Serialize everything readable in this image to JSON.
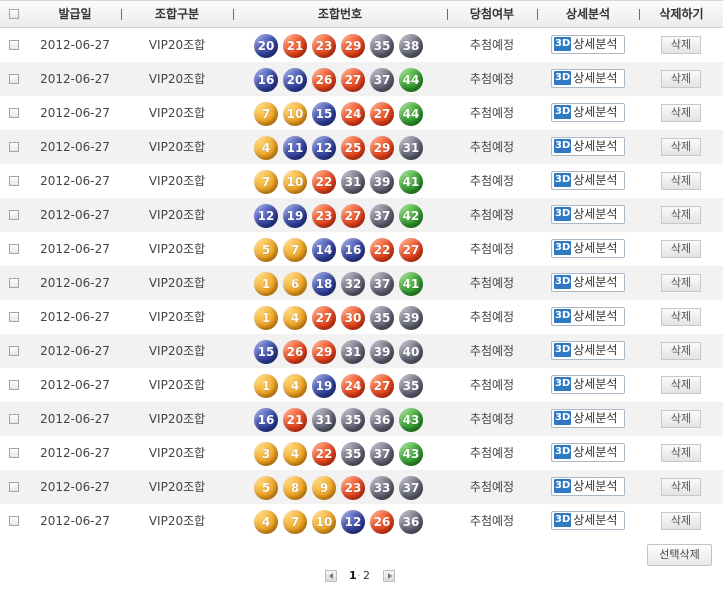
{
  "header": {
    "issue_date": "발급일",
    "combo_type": "조합구분",
    "combo_numbers": "조합번호",
    "win_status": "당첨여부",
    "detail_analysis": "상세분석",
    "delete": "삭제하기"
  },
  "ball_colors": {
    "yellow": "#f0a21e",
    "blue": "#2f3f9e",
    "red": "#e8401a",
    "gray": "#5e6073",
    "green": "#2f9a2b"
  },
  "row_labels": {
    "detail_badge": "3D",
    "detail_text": "상세분석",
    "delete_text": "삭제"
  },
  "rows": [
    {
      "date": "2012-06-27",
      "type": "VIP20조합",
      "status": "추첨예정",
      "numbers": [
        20,
        21,
        23,
        29,
        35,
        38
      ]
    },
    {
      "date": "2012-06-27",
      "type": "VIP20조합",
      "status": "추첨예정",
      "numbers": [
        16,
        20,
        26,
        27,
        37,
        44
      ]
    },
    {
      "date": "2012-06-27",
      "type": "VIP20조합",
      "status": "추첨예정",
      "numbers": [
        7,
        10,
        15,
        24,
        27,
        44
      ]
    },
    {
      "date": "2012-06-27",
      "type": "VIP20조합",
      "status": "추첨예정",
      "numbers": [
        4,
        11,
        12,
        25,
        29,
        31
      ]
    },
    {
      "date": "2012-06-27",
      "type": "VIP20조합",
      "status": "추첨예정",
      "numbers": [
        7,
        10,
        22,
        31,
        39,
        41
      ]
    },
    {
      "date": "2012-06-27",
      "type": "VIP20조합",
      "status": "추첨예정",
      "numbers": [
        12,
        19,
        23,
        27,
        37,
        42
      ]
    },
    {
      "date": "2012-06-27",
      "type": "VIP20조합",
      "status": "추첨예정",
      "numbers": [
        5,
        7,
        14,
        16,
        22,
        27
      ]
    },
    {
      "date": "2012-06-27",
      "type": "VIP20조합",
      "status": "추첨예정",
      "numbers": [
        1,
        6,
        18,
        32,
        37,
        41
      ]
    },
    {
      "date": "2012-06-27",
      "type": "VIP20조합",
      "status": "추첨예정",
      "numbers": [
        1,
        4,
        27,
        30,
        35,
        39
      ]
    },
    {
      "date": "2012-06-27",
      "type": "VIP20조합",
      "status": "추첨예정",
      "numbers": [
        15,
        26,
        29,
        31,
        39,
        40
      ]
    },
    {
      "date": "2012-06-27",
      "type": "VIP20조합",
      "status": "추첨예정",
      "numbers": [
        1,
        4,
        19,
        24,
        27,
        35
      ]
    },
    {
      "date": "2012-06-27",
      "type": "VIP20조합",
      "status": "추첨예정",
      "numbers": [
        16,
        21,
        31,
        35,
        36,
        43
      ]
    },
    {
      "date": "2012-06-27",
      "type": "VIP20조합",
      "status": "추첨예정",
      "numbers": [
        3,
        4,
        22,
        35,
        37,
        43
      ]
    },
    {
      "date": "2012-06-27",
      "type": "VIP20조합",
      "status": "추첨예정",
      "numbers": [
        5,
        8,
        9,
        23,
        33,
        37
      ]
    },
    {
      "date": "2012-06-27",
      "type": "VIP20조합",
      "status": "추첨예정",
      "numbers": [
        4,
        7,
        10,
        12,
        26,
        36
      ]
    }
  ],
  "actions": {
    "delete_selected": "선택삭제"
  },
  "pagination": {
    "pages": [
      "1",
      "2"
    ],
    "current": "1"
  }
}
